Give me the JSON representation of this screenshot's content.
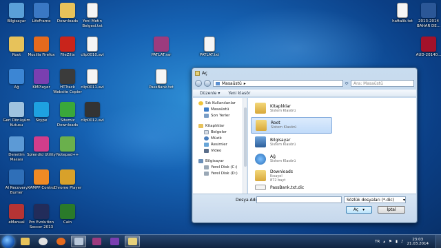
{
  "desktop": {
    "icons": [
      {
        "label": "Bilgisayar",
        "icon": "computer-icon",
        "color": "#5aa0d8"
      },
      {
        "label": "LifeFrame",
        "icon": "gear-icon",
        "color": "#3a78c4"
      },
      {
        "label": "Downloads",
        "icon": "folder-icon",
        "color": "#e7c25a"
      },
      {
        "label": "Yeni Metin Belgesi.txt",
        "icon": "text-file-icon",
        "color": "#f5f5f5"
      },
      {
        "label": "Root",
        "icon": "folder-icon",
        "color": "#e7c25a"
      },
      {
        "label": "Mozilla Firefox",
        "icon": "firefox-icon",
        "color": "#e56a1d"
      },
      {
        "label": "FileZilla",
        "icon": "filezilla-icon",
        "color": "#c9241b"
      },
      {
        "label": "clip0010.avi",
        "icon": "video-file-icon",
        "color": "#f5f5f5"
      },
      {
        "label": "Ağ",
        "icon": "network-icon",
        "color": "#3c86d4"
      },
      {
        "label": "KMPlayer",
        "icon": "kmplayer-icon",
        "color": "#7a3fb0"
      },
      {
        "label": "HTTrack Website Copier",
        "icon": "httrack-icon",
        "color": "#3b3b3b"
      },
      {
        "label": "clip0011.avi",
        "icon": "video-file-icon",
        "color": "#f5f5f5"
      },
      {
        "label": "Geri Dönüşüm Kutusu",
        "icon": "recycle-bin-icon",
        "color": "#9fc3df"
      },
      {
        "label": "Skype",
        "icon": "skype-icon",
        "color": "#1ea1e0"
      },
      {
        "label": "Sitemiz Downloads",
        "icon": "download-icon",
        "color": "#3aa83a"
      },
      {
        "label": "clip0012.avi",
        "icon": "avi-icon",
        "color": "#333333"
      },
      {
        "label": "Denetim Masası",
        "icon": "control-panel-icon",
        "color": "#5c9ad6"
      },
      {
        "label": "Splendid Utility",
        "icon": "splendid-icon",
        "color": "#d23d8b"
      },
      {
        "label": "Notepad++",
        "icon": "notepad-plus-icon",
        "color": "#6ab04c"
      },
      {
        "label": "AI Recovery Burner",
        "icon": "recovery-icon",
        "color": "#2f6fb8"
      },
      {
        "label": "XAMPP Control",
        "icon": "xampp-icon",
        "color": "#f08a24"
      },
      {
        "label": "Chrome Player",
        "icon": "player-icon",
        "color": "#d8a12a"
      },
      {
        "label": "eManual",
        "icon": "manual-icon",
        "color": "#b53434"
      },
      {
        "label": "Pro Evolution Soccer 2013",
        "icon": "game-icon",
        "color": "#222c5a"
      },
      {
        "label": "Cain",
        "icon": "cain-icon",
        "color": "#2a7a2a"
      },
      {
        "label": "PATLAT.rar",
        "icon": "rar-icon",
        "color": "#9c3b7e"
      },
      {
        "label": "PATLAT.txt",
        "icon": "text-file-icon",
        "color": "#f5f5f5"
      },
      {
        "label": "PassBank.txt",
        "icon": "text-file-icon",
        "color": "#f5f5f5"
      },
      {
        "label": "haftalik.txt",
        "icon": "text-file-icon",
        "color": "#f5f5f5"
      },
      {
        "label": "2013-2014 BAHAR DE...",
        "icon": "word-doc-icon",
        "color": "#2b5797"
      },
      {
        "label": "AUD-20140...",
        "icon": "mp3-icon",
        "color": "#a3122a"
      }
    ]
  },
  "dialog": {
    "title": "Aç",
    "address": "Masaüstü",
    "search_placeholder": "Ara: Masaüstü",
    "toolbar": {
      "organize": "Düzenle ▾",
      "new_folder": "Yeni klasör"
    },
    "nav": {
      "favorites": "Sık Kullanılanlar",
      "favorites_items": [
        "Masaüstü",
        "Son Yerler"
      ],
      "libraries": "Kitaplıklar",
      "libraries_items": [
        "Belgeler",
        "Müzik",
        "Resimler",
        "Video"
      ],
      "computer": "Bilgisayar",
      "computer_items": [
        "Yerel Disk (C:)",
        "Yerel Disk (D:)"
      ]
    },
    "files": [
      {
        "name": "Kitaplıklar",
        "sub": "Sistem Klasörü",
        "icon": "libraries-icon"
      },
      {
        "name": "Root",
        "sub": "Sistem Klasörü",
        "icon": "user-folder-icon"
      },
      {
        "name": "Bilgisayar",
        "sub": "Sistem Klasörü",
        "icon": "computer-icon"
      },
      {
        "name": "Ağ",
        "sub": "Sistem Klasörü",
        "icon": "network-icon"
      },
      {
        "name": "Downloads",
        "sub": "Kısayol",
        "sub2": "872 bayt",
        "icon": "folder-icon"
      },
      {
        "name": "PassBank.txt.dic",
        "sub": "",
        "icon": "text-file-icon"
      }
    ],
    "filename_label": "Dosya Adı:",
    "filename_value": "",
    "filetype": "Sözlük dosyaları (*.dic)",
    "open_button": "Aç",
    "cancel_button": "İptal"
  },
  "taskbar": {
    "language": "TR",
    "time": "23:03",
    "date": "21.03.2014"
  }
}
